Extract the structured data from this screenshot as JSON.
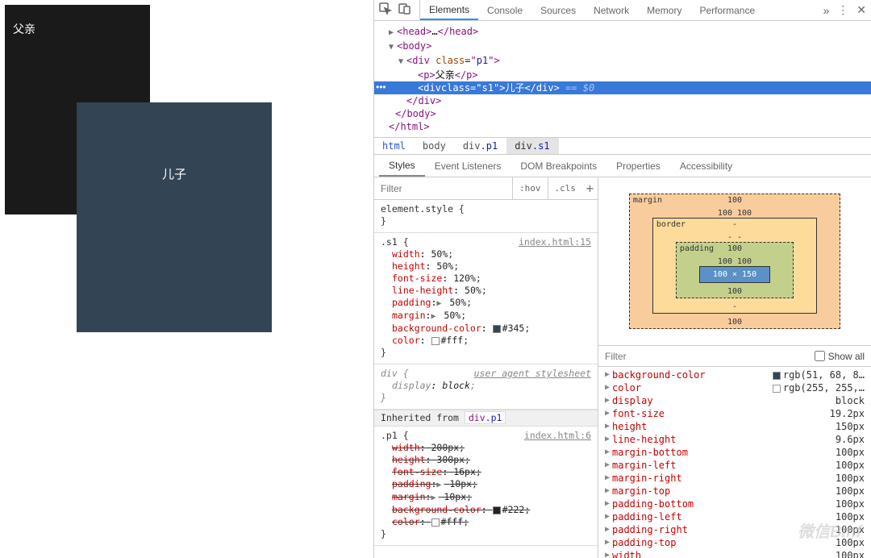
{
  "preview": {
    "parent_label": "父亲",
    "child_label": "儿子"
  },
  "toolbar": {
    "tabs": [
      "Elements",
      "Console",
      "Sources",
      "Network",
      "Memory",
      "Performance"
    ],
    "more": "»",
    "menu": "⋮",
    "close": "✕"
  },
  "dom_tree": {
    "line0": "<head>…</head>",
    "line1": "<body>",
    "line2": "<div class=\"p1\">",
    "line3a": "<p>",
    "line3b": "父亲",
    "line3c": "</p>",
    "selected_html": "<div class=\"s1\">儿子</div>",
    "selected_eq": " == $0",
    "line5": "</div>",
    "line6": "</body>",
    "line7": "</html>"
  },
  "breadcrumb": {
    "items": [
      {
        "text": "html",
        "cls": ""
      },
      {
        "text": "body",
        "cls": ""
      },
      {
        "text": "div",
        "cls": ".p1"
      },
      {
        "text": "div",
        "cls": ".s1"
      }
    ]
  },
  "styles_tabs": [
    "Styles",
    "Event Listeners",
    "DOM Breakpoints",
    "Properties",
    "Accessibility"
  ],
  "filter": {
    "placeholder": "Filter",
    "hov": ":hov",
    "cls": ".cls"
  },
  "rules": {
    "element_style": "element.style {",
    "s1": {
      "selector": ".s1 {",
      "source": "index.html:15",
      "props": [
        {
          "n": "width",
          "v": "50%"
        },
        {
          "n": "height",
          "v": "50%"
        },
        {
          "n": "font-size",
          "v": "120%"
        },
        {
          "n": "line-height",
          "v": "50%"
        },
        {
          "n": "padding",
          "v": "50%",
          "tri": true
        },
        {
          "n": "margin",
          "v": "50%",
          "tri": true
        },
        {
          "n": "background-color",
          "v": "#345",
          "swatch": "#334455"
        },
        {
          "n": "color",
          "v": "#fff",
          "swatch": "#ffffff"
        }
      ]
    },
    "uas": {
      "selector": "div {",
      "source": "user agent stylesheet",
      "props": [
        {
          "n": "display",
          "v": "block"
        }
      ]
    },
    "inherit": "Inherited from ",
    "inherit_link_tag": "div",
    "inherit_link_cls": ".p1",
    "p1": {
      "selector": ".p1 {",
      "source": "index.html:6",
      "props": [
        {
          "n": "width",
          "v": "200px",
          "strike": true
        },
        {
          "n": "height",
          "v": "300px",
          "strike": true
        },
        {
          "n": "font-size",
          "v": "16px",
          "strike": true
        },
        {
          "n": "padding",
          "v": "10px",
          "tri": true,
          "strike": true
        },
        {
          "n": "margin",
          "v": "10px",
          "tri": true,
          "strike": true
        },
        {
          "n": "background-color",
          "v": "#222",
          "swatch": "#222222",
          "strike": true
        },
        {
          "n": "color",
          "v": "#fff",
          "swatch": "#ffffff",
          "strike": true
        }
      ]
    },
    "close_brace": "}"
  },
  "boxmodel": {
    "labels": {
      "margin": "margin",
      "border": "border",
      "padding": "padding"
    },
    "margin": {
      "t": "100",
      "r": "100",
      "b": "100",
      "l": "100"
    },
    "border": {
      "t": "-",
      "r": "-",
      "b": "-",
      "l": "-"
    },
    "padding": {
      "t": "100",
      "r": "100",
      "b": "100",
      "l": "100"
    },
    "content": "100 × 150"
  },
  "computed_filter": {
    "placeholder": "Filter",
    "show_all": "Show all"
  },
  "computed": [
    {
      "n": "background-color",
      "v": "rgb(51, 68, 8…",
      "sw": "#334458"
    },
    {
      "n": "color",
      "v": "rgb(255, 255,…",
      "sw": "#ffffff"
    },
    {
      "n": "display",
      "v": "block"
    },
    {
      "n": "font-size",
      "v": "19.2px"
    },
    {
      "n": "height",
      "v": "150px"
    },
    {
      "n": "line-height",
      "v": "9.6px"
    },
    {
      "n": "margin-bottom",
      "v": "100px"
    },
    {
      "n": "margin-left",
      "v": "100px"
    },
    {
      "n": "margin-right",
      "v": "100px"
    },
    {
      "n": "margin-top",
      "v": "100px"
    },
    {
      "n": "padding-bottom",
      "v": "100px"
    },
    {
      "n": "padding-left",
      "v": "100px"
    },
    {
      "n": "padding-right",
      "v": "100px"
    },
    {
      "n": "padding-top",
      "v": "100px"
    },
    {
      "n": "width",
      "v": "100px"
    }
  ],
  "watermark": "微信Binf"
}
